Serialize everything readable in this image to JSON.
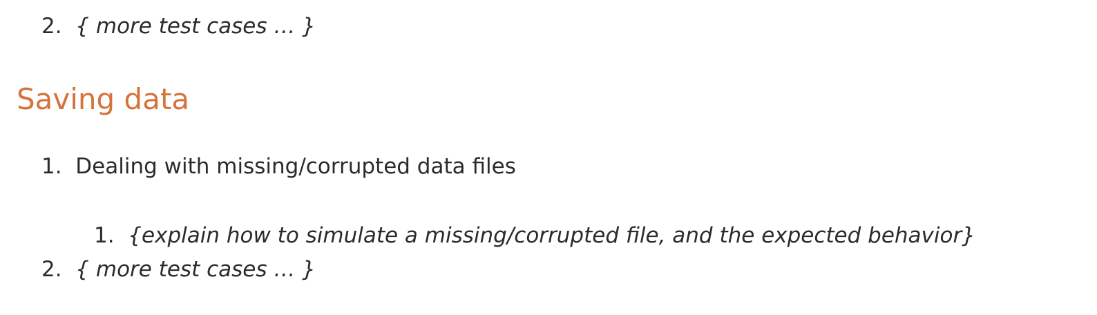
{
  "top_list": {
    "item_2": {
      "number": "2.",
      "text": "{ more test cases … }"
    }
  },
  "section": {
    "heading": "Saving data",
    "heading_color": "#d4733a",
    "list": {
      "item_1": {
        "number": "1.",
        "text": "Dealing with missing/corrupted data files",
        "sub_item_1": {
          "number": "1.",
          "text": "{explain how to simulate a missing/corrupted file, and the expected behavior}"
        }
      },
      "item_2": {
        "number": "2.",
        "text": "{ more test cases … }"
      }
    }
  }
}
